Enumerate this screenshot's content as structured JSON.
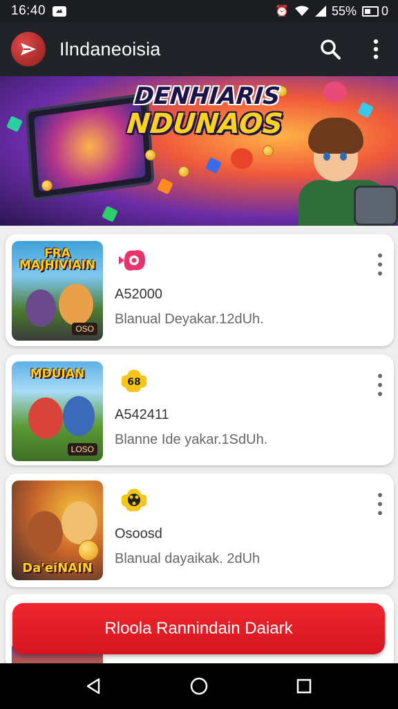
{
  "status_bar": {
    "time": "16:40",
    "battery_text": "55%",
    "battery_suffix": "0"
  },
  "app_bar": {
    "title": "Ilndaneoisia",
    "search_icon": "search-icon",
    "menu_icon": "more-vert-icon"
  },
  "banner": {
    "title_line1": "DENHIARIS",
    "title_line2": "NDUNAOS"
  },
  "cards": [
    {
      "thumb_title": "FRA\nMAJHIVIAIN",
      "thumb_badge": "OSO",
      "code": "A52000",
      "description": "Blanual Deyakar.12dUh.",
      "icon_color": "#e8336d",
      "thumb_colors": [
        "#3fa0d8",
        "#4b7a2e"
      ]
    },
    {
      "thumb_title": "MDUIAN",
      "thumb_badge": "LOSO",
      "code": "A542411",
      "description": "Blanne Ide yakar.1SdUh.",
      "icon_color": "#f5c518",
      "thumb_colors": [
        "#5fb0e8",
        "#5a9a34"
      ]
    },
    {
      "thumb_title": "Da'eiNAIN",
      "thumb_badge": "",
      "code": "Osoosd",
      "description": "Blanual dayaikak. 2dUh",
      "icon_color": "#f5c518",
      "thumb_colors": [
        "#3a2a2a",
        "#c9652a"
      ]
    }
  ],
  "cta": {
    "label": "Rloola Rannindain Daiark"
  },
  "nav": {
    "back": "back-icon",
    "home": "home-icon",
    "recents": "recents-icon"
  }
}
